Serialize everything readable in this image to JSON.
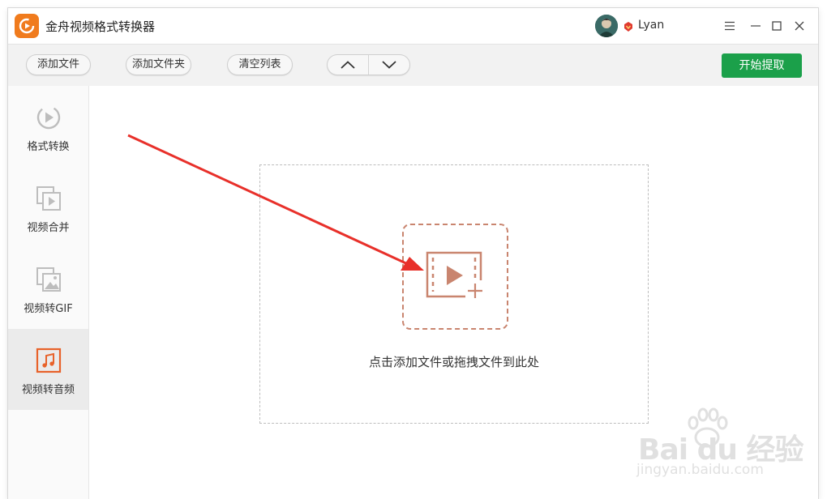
{
  "app": {
    "title": "金舟视频格式转换器",
    "logo_color": "#f07b1d"
  },
  "user": {
    "name": "Lyan"
  },
  "window_controls": [
    "menu-icon",
    "minimize-icon",
    "maximize-icon",
    "close-icon"
  ],
  "toolbar": {
    "add_file": "添加文件",
    "add_folder": "添加文件夹",
    "clear_list": "清空列表",
    "start_label": "开始提取",
    "start_color": "#1ba04a"
  },
  "sidebar": {
    "items": [
      {
        "label": "格式转换",
        "icon": "convert-play-icon",
        "active": false
      },
      {
        "label": "视频合并",
        "icon": "video-merge-icon",
        "active": false
      },
      {
        "label": "视频转GIF",
        "icon": "gif-image-icon",
        "active": false
      },
      {
        "label": "视频转音频",
        "icon": "music-note-icon",
        "active": true
      }
    ]
  },
  "main": {
    "drop_text": "点击添加文件或拖拽文件到此处",
    "accent_color": "#c9856f",
    "annotation_arrow_color": "#e8302a"
  },
  "watermark": {
    "brand": "Bai du 经验",
    "url": "jingyan.baidu.com"
  }
}
